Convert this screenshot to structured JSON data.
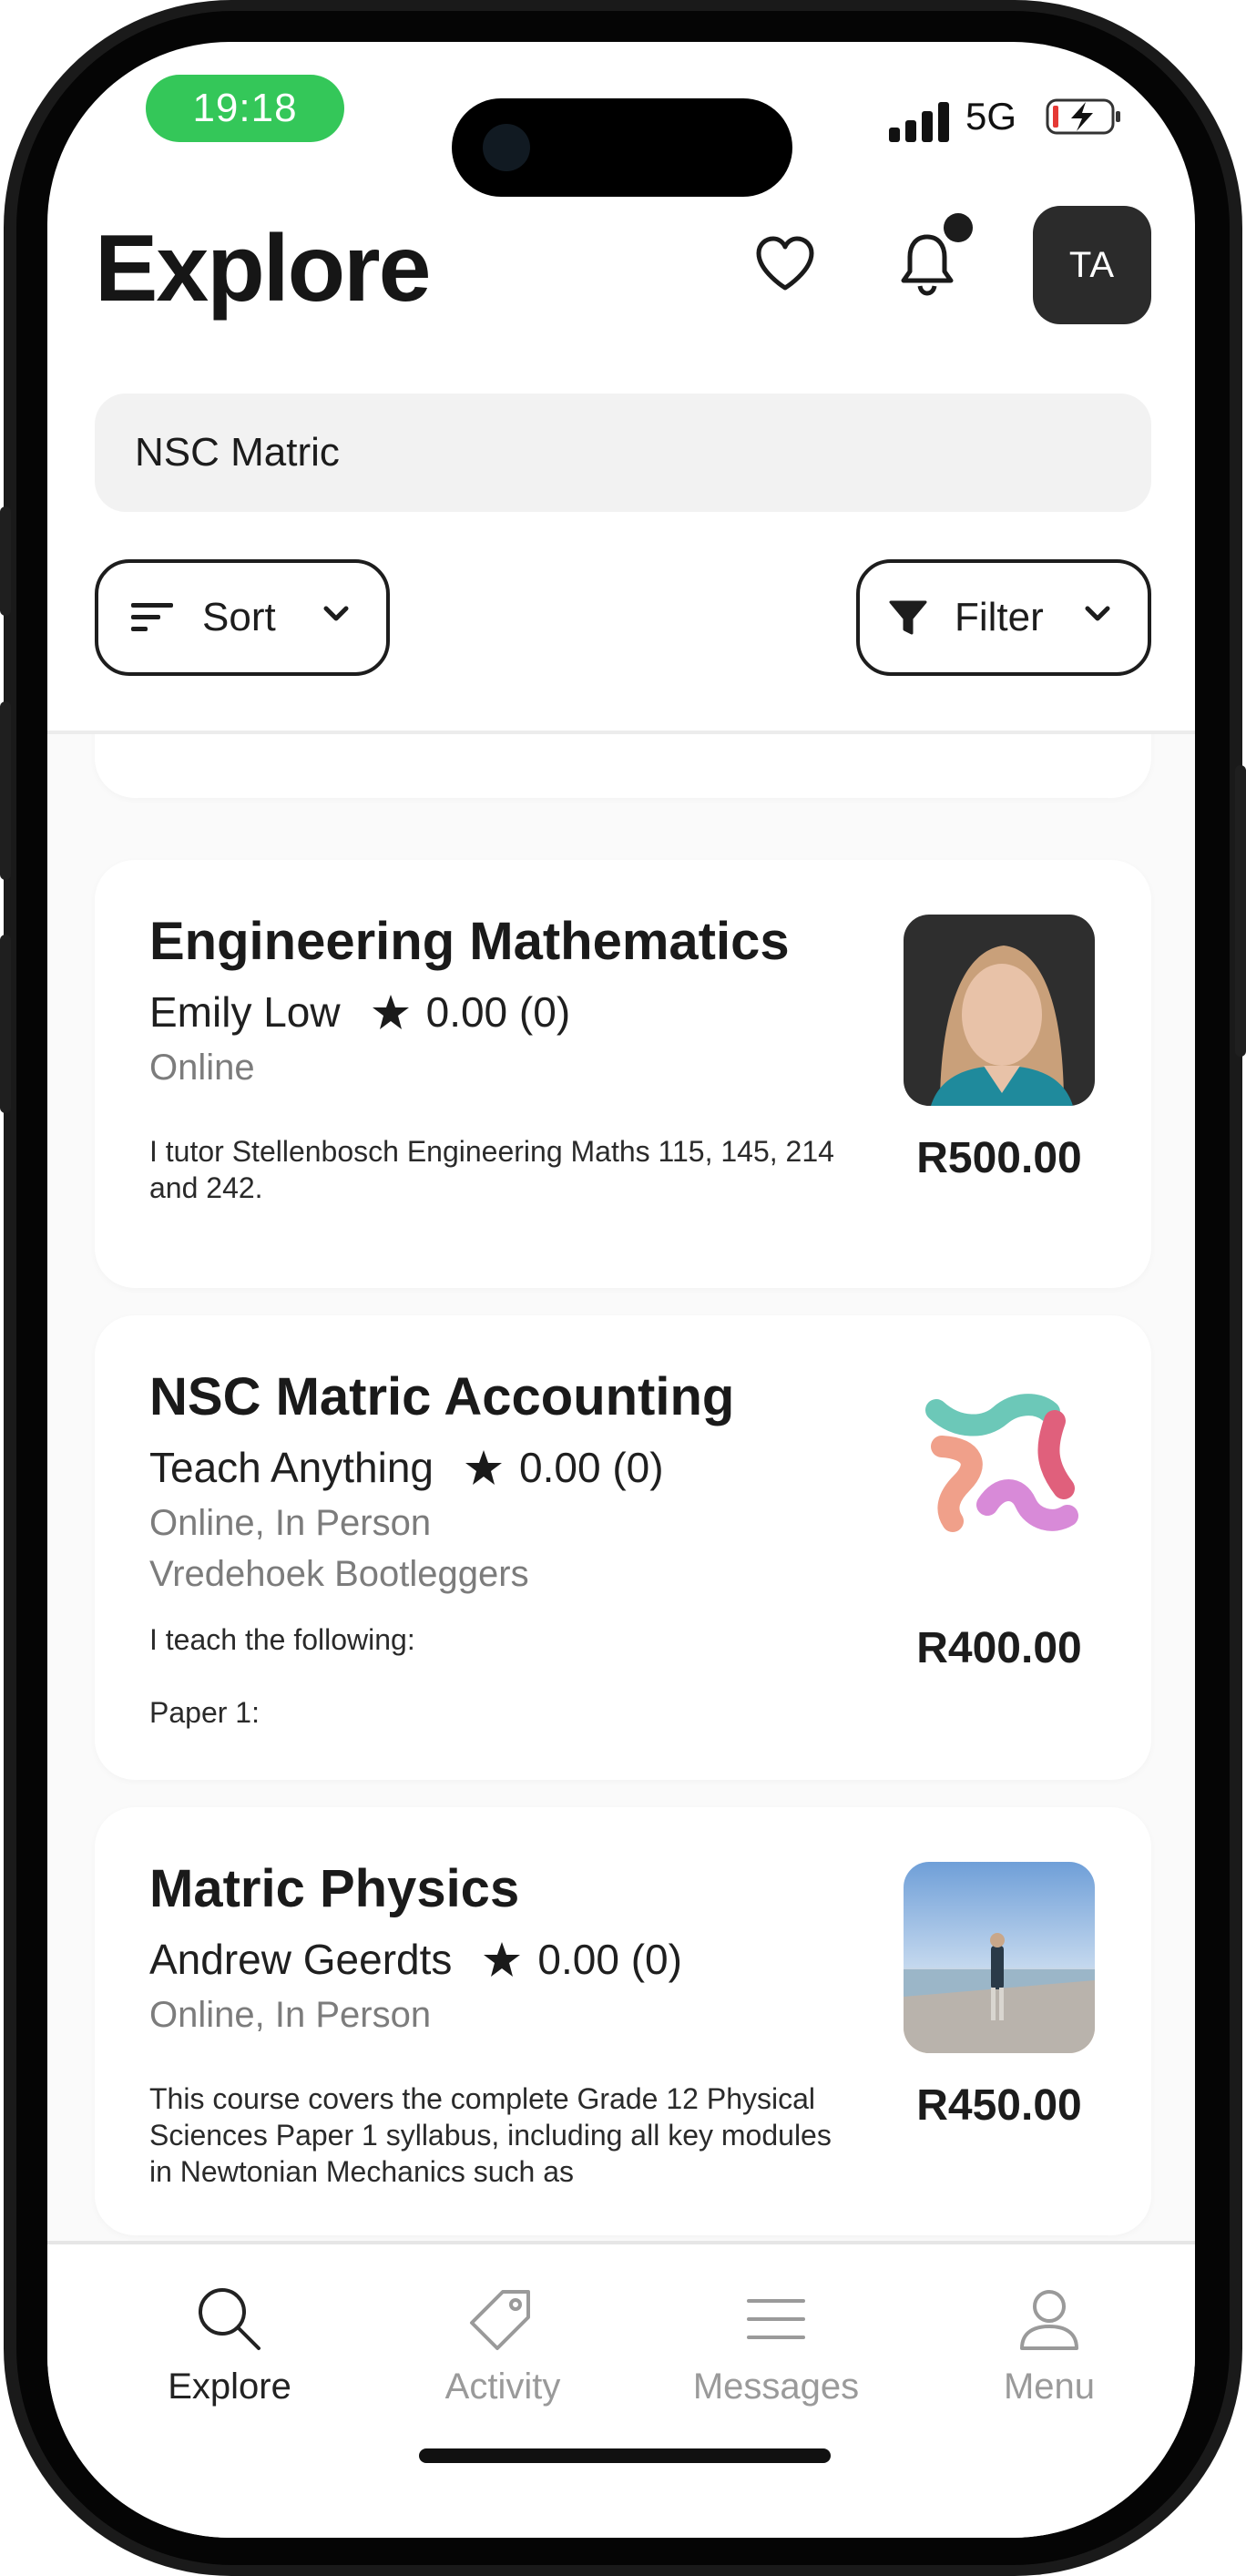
{
  "status_bar": {
    "time": "19:18",
    "network": "5G"
  },
  "header": {
    "title": "Explore",
    "avatar_initials": "TA"
  },
  "search": {
    "value": "NSC Matric"
  },
  "controls": {
    "sort_label": "Sort",
    "filter_label": "Filter"
  },
  "listings": [
    {
      "title": "Engineering Mathematics",
      "tutor": "Emily Low",
      "rating": "0.00 (0)",
      "modes": "Online",
      "location": "",
      "description": "I tutor Stellenbosch Engineering Maths 115, 145, 214 and 242.",
      "price": "R500.00",
      "image": "tutor-photo"
    },
    {
      "title": "NSC Matric Accounting",
      "tutor": "Teach Anything",
      "rating": "0.00 (0)",
      "modes": "Online, In Person",
      "location": "Vredehoek Bootleggers",
      "description_lines": [
        "I teach the following:",
        "Paper 1:"
      ],
      "price": "R400.00",
      "image": "teach-anything-logo"
    },
    {
      "title": "Matric Physics",
      "tutor": "Andrew Geerdts",
      "rating": "0.00 (0)",
      "modes": "Online, In Person",
      "location": "",
      "description": "This course covers the complete Grade 12 Physical Sciences Paper 1 syllabus, including all key modules in Newtonian Mechanics such as",
      "price": "R450.00",
      "image": "beach-photo"
    }
  ],
  "bottom_nav": {
    "items": [
      {
        "label": "Explore",
        "icon": "search-icon",
        "active": true
      },
      {
        "label": "Activity",
        "icon": "tag-icon",
        "active": false
      },
      {
        "label": "Messages",
        "icon": "menu-lines-icon",
        "active": false
      },
      {
        "label": "Menu",
        "icon": "user-icon",
        "active": false
      }
    ]
  },
  "colors": {
    "status_pill": "#34c759",
    "avatar_bg": "#2b2b2b",
    "inactive_nav": "#9a9a9a"
  }
}
